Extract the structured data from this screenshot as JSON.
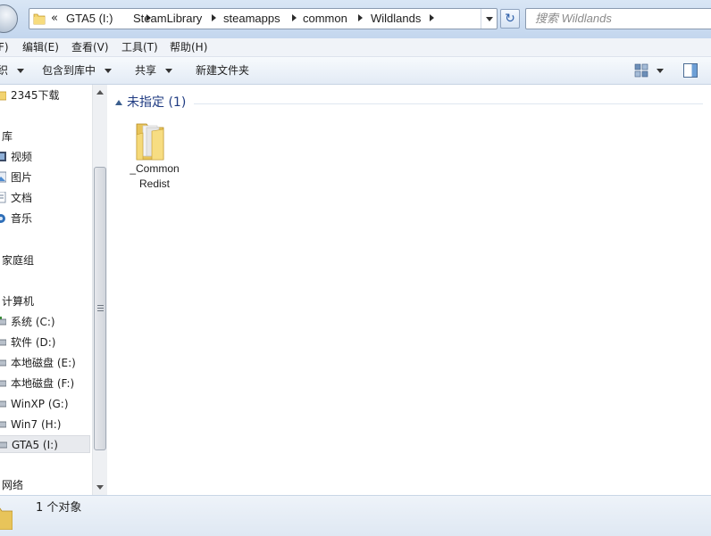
{
  "address_bar": {
    "overflow_chevron": "«",
    "breadcrumbs": [
      "GTA5 (I:)",
      "SteamLibrary",
      "steamapps",
      "common",
      "Wildlands"
    ],
    "refresh_glyph": "↻"
  },
  "search": {
    "placeholder": "搜索 Wildlands"
  },
  "menu": {
    "items": [
      "F)",
      "编辑(E)",
      "查看(V)",
      "工具(T)",
      "帮助(H)"
    ]
  },
  "toolbar": {
    "organize": "织",
    "include_in_library": "包含到库中",
    "share": "共享",
    "new_folder": "新建文件夹"
  },
  "nav": {
    "items": [
      {
        "label": "2345下载",
        "icon": "folder-icon"
      },
      {
        "label": "库",
        "icon": "library-icon"
      },
      {
        "label": "视频",
        "icon": "video-library-icon"
      },
      {
        "label": "图片",
        "icon": "pictures-library-icon"
      },
      {
        "label": "文档",
        "icon": "documents-library-icon"
      },
      {
        "label": "音乐",
        "icon": "music-library-icon"
      },
      {
        "label": "家庭组",
        "icon": "homegroup-icon"
      },
      {
        "label": "计算机",
        "icon": "computer-icon"
      },
      {
        "label": "系统 (C:)",
        "icon": "drive-icon"
      },
      {
        "label": "软件 (D:)",
        "icon": "drive-icon"
      },
      {
        "label": "本地磁盘 (E:)",
        "icon": "drive-icon"
      },
      {
        "label": "本地磁盘 (F:)",
        "icon": "drive-icon"
      },
      {
        "label": "WinXP (G:)",
        "icon": "drive-icon"
      },
      {
        "label": "Win7 (H:)",
        "icon": "drive-icon"
      },
      {
        "label": "GTA5 (I:)",
        "icon": "drive-icon",
        "selected": true
      },
      {
        "label": "网络",
        "icon": "network-icon"
      }
    ]
  },
  "content": {
    "group_title": "未指定 (1)",
    "files": [
      {
        "name_line1": "_Common",
        "name_line2": "Redist",
        "icon": "folder-icon"
      }
    ]
  },
  "status": {
    "text": "1 个对象"
  },
  "colors": {
    "group_title": "#1f3b82",
    "address_bar_bg": "#c3d6ee",
    "selected_nav_bg": "#e8eaee"
  }
}
